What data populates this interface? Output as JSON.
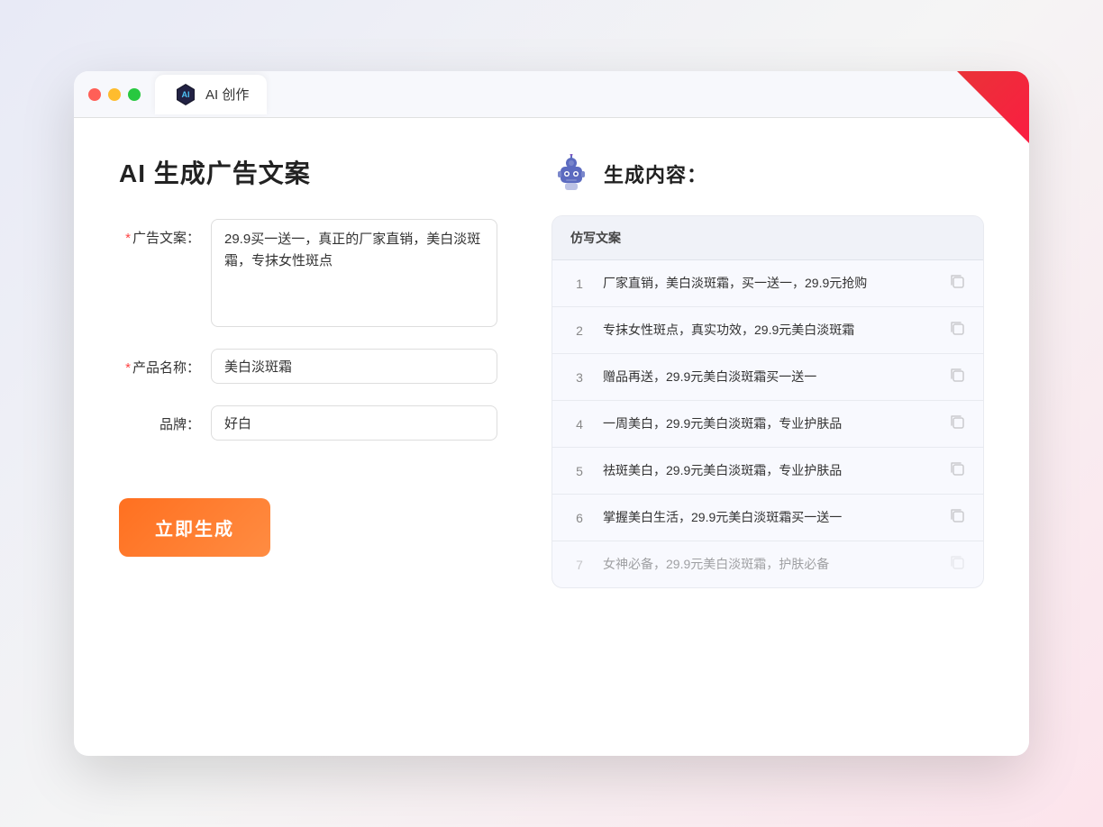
{
  "browser": {
    "tab_label": "AI 创作"
  },
  "page": {
    "title": "AI 生成广告文案",
    "result_title": "生成内容："
  },
  "form": {
    "ad_copy_label": "广告文案：",
    "ad_copy_value": "29.9买一送一，真正的厂家直销，美白淡斑霜，专抹女性斑点",
    "product_name_label": "产品名称：",
    "product_name_value": "美白淡斑霜",
    "brand_label": "品牌：",
    "brand_value": "好白",
    "generate_button": "立即生成"
  },
  "results": {
    "column_header": "仿写文案",
    "items": [
      {
        "num": "1",
        "text": "厂家直销，美白淡斑霜，买一送一，29.9元抢购",
        "dimmed": false
      },
      {
        "num": "2",
        "text": "专抹女性斑点，真实功效，29.9元美白淡斑霜",
        "dimmed": false
      },
      {
        "num": "3",
        "text": "赠品再送，29.9元美白淡斑霜买一送一",
        "dimmed": false
      },
      {
        "num": "4",
        "text": "一周美白，29.9元美白淡斑霜，专业护肤品",
        "dimmed": false
      },
      {
        "num": "5",
        "text": "祛斑美白，29.9元美白淡斑霜，专业护肤品",
        "dimmed": false
      },
      {
        "num": "6",
        "text": "掌握美白生活，29.9元美白淡斑霜买一送一",
        "dimmed": false
      },
      {
        "num": "7",
        "text": "女神必备，29.9元美白淡斑霜，护肤必备",
        "dimmed": true
      }
    ]
  }
}
